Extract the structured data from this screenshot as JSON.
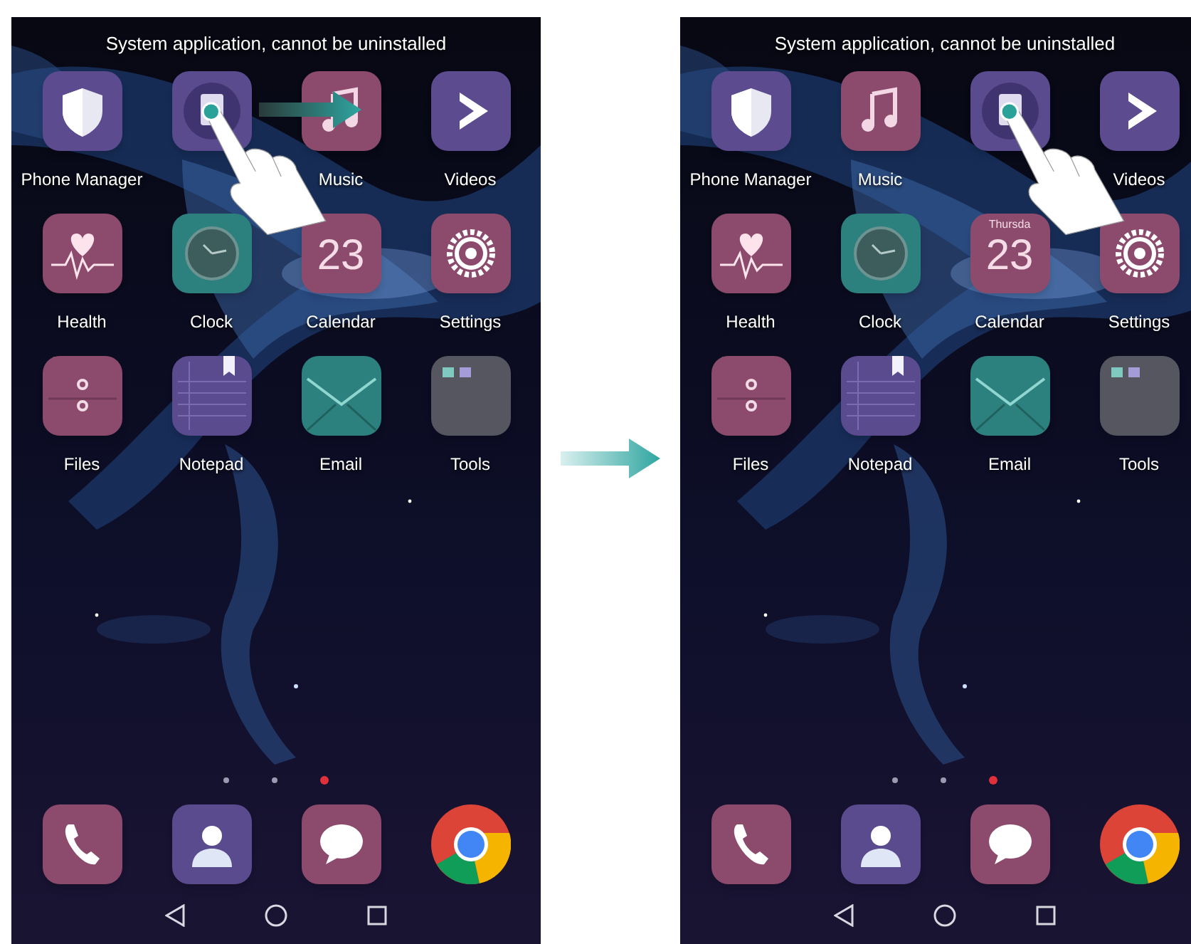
{
  "screens": [
    {
      "notice": "System application, cannot be uninstalled",
      "drag_arrow": true,
      "apps": [
        {
          "kind": "shield",
          "label": "Phone Manager"
        },
        {
          "kind": "held"
        },
        {
          "kind": "music",
          "label": "Music"
        },
        {
          "kind": "videos",
          "label": "Videos"
        },
        {
          "kind": "health",
          "label": "Health"
        },
        {
          "kind": "clock",
          "label": "Clock"
        },
        {
          "kind": "calendar",
          "label": "Calendar",
          "date": "23"
        },
        {
          "kind": "settings",
          "label": "Settings"
        },
        {
          "kind": "files",
          "label": "Files"
        },
        {
          "kind": "notepad",
          "label": "Notepad"
        },
        {
          "kind": "email",
          "label": "Email"
        },
        {
          "kind": "tools",
          "label": "Tools"
        }
      ],
      "page_dots": [
        {
          "selected": false
        },
        {
          "selected": false
        },
        {
          "selected": true
        }
      ],
      "dock": [
        {
          "kind": "phone"
        },
        {
          "kind": "contacts"
        },
        {
          "kind": "messages"
        },
        {
          "kind": "browser"
        }
      ]
    },
    {
      "notice": "System application, cannot be uninstalled",
      "drag_arrow": false,
      "apps": [
        {
          "kind": "shield",
          "label": "Phone Manager"
        },
        {
          "kind": "music",
          "label": "Music"
        },
        {
          "kind": "held"
        },
        {
          "kind": "videos",
          "label": "Videos"
        },
        {
          "kind": "health",
          "label": "Health"
        },
        {
          "kind": "clock",
          "label": "Clock"
        },
        {
          "kind": "calendar",
          "label": "Calendar",
          "date": "23",
          "weekday": "Thursda"
        },
        {
          "kind": "settings",
          "label": "Settings"
        },
        {
          "kind": "files",
          "label": "Files"
        },
        {
          "kind": "notepad",
          "label": "Notepad"
        },
        {
          "kind": "email",
          "label": "Email"
        },
        {
          "kind": "tools",
          "label": "Tools"
        }
      ],
      "page_dots": [
        {
          "selected": false
        },
        {
          "selected": false
        },
        {
          "selected": true
        }
      ],
      "dock": [
        {
          "kind": "phone"
        },
        {
          "kind": "contacts"
        },
        {
          "kind": "messages"
        },
        {
          "kind": "browser"
        }
      ]
    }
  ]
}
